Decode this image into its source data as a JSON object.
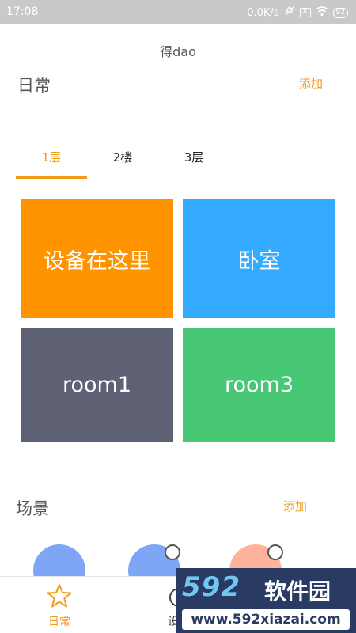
{
  "status_bar": {
    "time": "17:08",
    "network_speed": "0.0K/s",
    "battery": "93",
    "icons": [
      "mute-icon",
      "sim-icon",
      "wifi-icon",
      "battery-icon"
    ]
  },
  "app_title": "得dao",
  "daily": {
    "title": "日常",
    "add_label": "添加"
  },
  "floors": {
    "tabs": [
      {
        "label": "1层",
        "active": true
      },
      {
        "label": "2楼",
        "active": false
      },
      {
        "label": "3层",
        "active": false
      }
    ]
  },
  "rooms": [
    {
      "name": "设备在这里",
      "color": "#ff9400"
    },
    {
      "name": "卧室",
      "color": "#35abff"
    },
    {
      "name": "room1",
      "color": "#5f6174"
    },
    {
      "name": "room3",
      "color": "#48c774"
    }
  ],
  "scenes": {
    "title": "场景",
    "add_label": "添加",
    "items": [
      {
        "color": "#7fa6f6"
      },
      {
        "color": "#7fa6f6"
      },
      {
        "color": "#ffb39c"
      }
    ]
  },
  "bottom_nav": {
    "items": [
      {
        "label": "日常",
        "icon": "star-icon",
        "active": true
      },
      {
        "label": "设备",
        "icon": "device-icon",
        "active": false
      }
    ]
  },
  "watermark": {
    "brand_num": "592",
    "brand_cn": "软件园",
    "url": "www.592xiazai.com"
  },
  "colors": {
    "accent": "#f39b1a",
    "status_bar": "#c9c9c9",
    "watermark_bg": "#2a3b63"
  }
}
